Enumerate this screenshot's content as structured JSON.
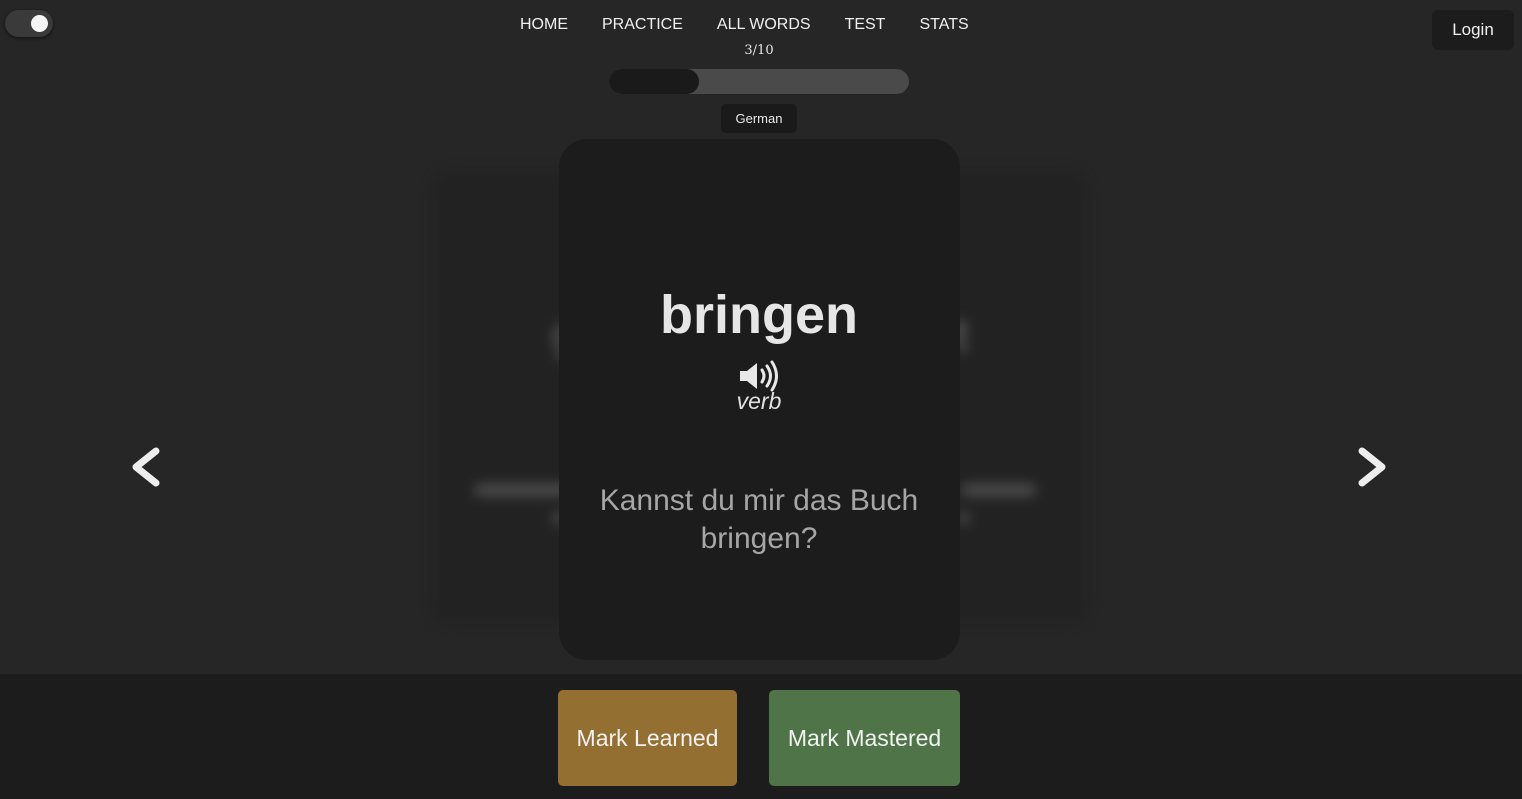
{
  "nav": {
    "items": [
      "HOME",
      "PRACTICE",
      "ALL WORDS",
      "TEST",
      "STATS"
    ]
  },
  "header": {
    "login_label": "Login",
    "counter": "3/10",
    "progress": 0.3,
    "language": "German"
  },
  "card": {
    "word": "bringen",
    "part_of_speech": "verb",
    "example": "Kannst du mir das Buch bringen?",
    "speaker_icon": "speaker-icon"
  },
  "navigation": {
    "prev_icon": "chevron-left-icon",
    "next_icon": "chevron-right-icon"
  },
  "actions": {
    "learned_label": "Mark Learned",
    "mastered_label": "Mark Mastered"
  },
  "colors": {
    "background": "#262626",
    "card": "#1c1c1c",
    "learned": "#946f32",
    "mastered": "#4e7447"
  }
}
